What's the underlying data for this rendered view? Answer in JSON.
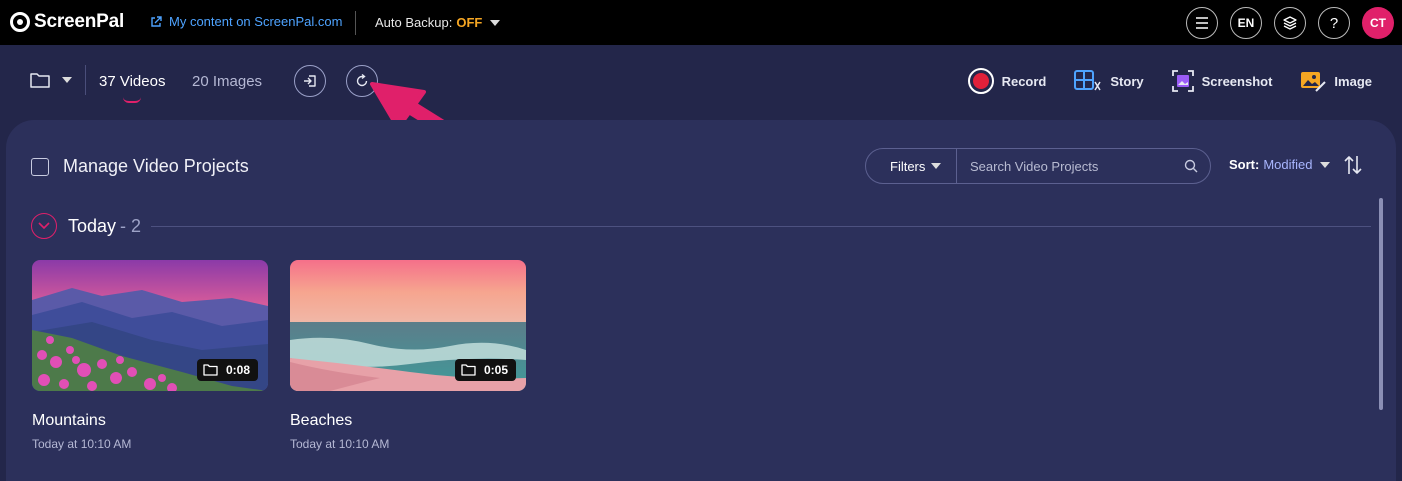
{
  "topbar": {
    "logo_text": "ScreenPal",
    "my_content_prefix": "My content on ",
    "my_content_site": "ScreenPal.com",
    "auto_backup_label": "Auto Backup:",
    "auto_backup_value": "OFF",
    "language": "EN",
    "help": "?",
    "user_initials": "CT"
  },
  "toolbar": {
    "videos_tab": "37 Videos",
    "images_tab": "20 Images",
    "actions": {
      "record": "Record",
      "story": "Story",
      "screenshot": "Screenshot",
      "image": "Image"
    }
  },
  "panel": {
    "manage_label": "Manage Video Projects",
    "filters_label": "Filters",
    "search_placeholder": "Search Video Projects",
    "sort_label": "Sort:",
    "sort_value": "Modified",
    "section_title": "Today",
    "section_count": " - 2",
    "videos": [
      {
        "title": "Mountains",
        "date": "Today at 10:10 AM",
        "duration": "0:08"
      },
      {
        "title": "Beaches",
        "date": "Today at 10:10 AM",
        "duration": "0:05"
      }
    ]
  },
  "colors": {
    "accent_pink": "#e0206a",
    "link_blue": "#4ea3ff",
    "backup_off": "#f5a623",
    "record_red": "#e0203a"
  }
}
